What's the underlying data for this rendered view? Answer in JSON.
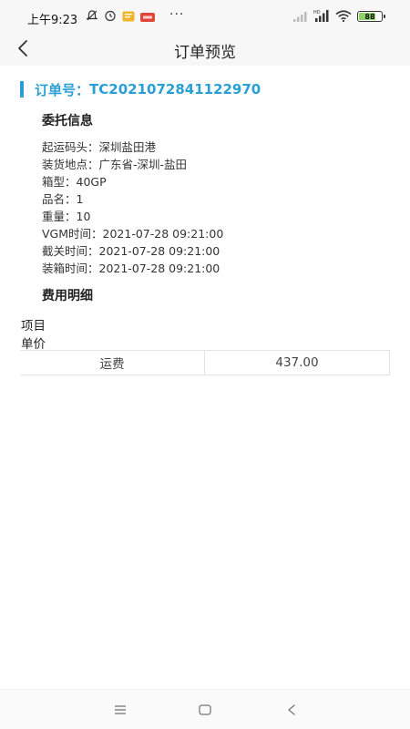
{
  "status_bar": {
    "time": "上午9:23",
    "battery": "88",
    "icons": [
      "mute-icon",
      "alarm-icon",
      "message-icon",
      "app-notification-icon",
      "signal-icon",
      "hd-signal-icon",
      "wifi-icon",
      "battery-icon"
    ]
  },
  "nav": {
    "title": "订单预览"
  },
  "order": {
    "label": "订单号：",
    "number": "TC2021072841122970"
  },
  "consign": {
    "title": "委托信息",
    "lines": [
      "起运码头：深圳盐田港",
      "装货地点：广东省-深圳-盐田",
      "箱型：40GP",
      "品名：1",
      "重量：10",
      "VGM时间：2021-07-28 09:21:00",
      "截关时间：2021-07-28 09:21:00",
      "装箱时间：2021-07-28 09:21:00"
    ]
  },
  "fees": {
    "title": "费用明细",
    "header_item": "项目",
    "header_price": "单价",
    "rows": [
      {
        "item": "运费",
        "price": "437.00"
      }
    ]
  },
  "colors": {
    "accent": "#2a9fd6"
  }
}
